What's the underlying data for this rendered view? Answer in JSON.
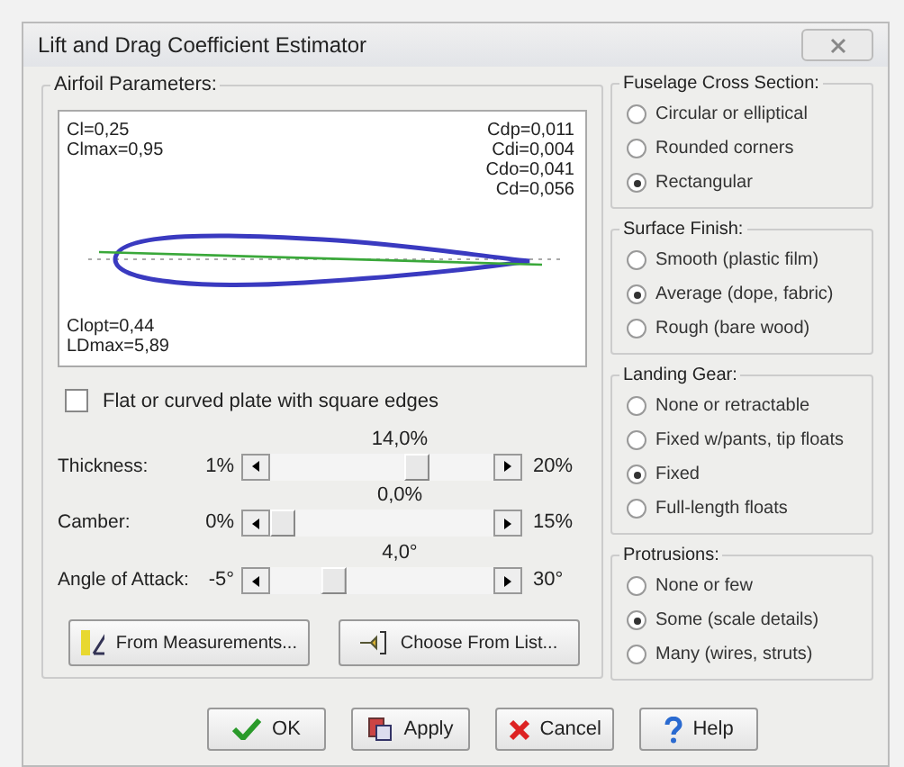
{
  "window": {
    "title": "Lift and Drag Coefficient Estimator"
  },
  "airfoil": {
    "title": "Airfoil Parameters:",
    "top_left": [
      "Cl=0,25",
      "Clmax=0,95"
    ],
    "top_right": [
      "Cdp=0,011",
      "Cdi=0,004",
      "Cdo=0,041",
      "Cd=0,056"
    ],
    "bottom_left": [
      "Clopt=0,44",
      "LDmax=5,89"
    ]
  },
  "flat_plate": {
    "label": "Flat or curved plate with square edges",
    "checked": false
  },
  "sliders": [
    {
      "label": "Thickness:",
      "min": "1%",
      "max": "20%",
      "reading": "14,0%",
      "level": 0.68
    },
    {
      "label": "Camber:",
      "min": "0%",
      "max": "15%",
      "reading": "0,0%",
      "level": 0.0
    },
    {
      "label": "Angle of Attack:",
      "min": "-5°",
      "max": "30°",
      "reading": "4,0°",
      "level": 0.26
    }
  ],
  "tool_buttons": [
    {
      "label": "From Measurements...",
      "kind": "measure"
    },
    {
      "label": "Choose From List...",
      "kind": "list"
    }
  ],
  "groups": [
    {
      "title": "Fuselage Cross Section:",
      "options": [
        {
          "label": "Circular or elliptical",
          "selected": false
        },
        {
          "label": "Rounded corners",
          "selected": false
        },
        {
          "label": "Rectangular",
          "selected": true
        }
      ]
    },
    {
      "title": "Surface Finish:",
      "options": [
        {
          "label": "Smooth (plastic film)",
          "selected": false
        },
        {
          "label": "Average (dope, fabric)",
          "selected": true
        },
        {
          "label": "Rough (bare wood)",
          "selected": false
        }
      ]
    },
    {
      "title": "Landing Gear:",
      "options": [
        {
          "label": "None or retractable",
          "selected": false
        },
        {
          "label": "Fixed w/pants, tip floats",
          "selected": false
        },
        {
          "label": "Fixed",
          "selected": true
        },
        {
          "label": "Full-length floats",
          "selected": false
        }
      ]
    },
    {
      "title": "Protrusions:",
      "options": [
        {
          "label": "None or few",
          "selected": false
        },
        {
          "label": "Some (scale details)",
          "selected": true
        },
        {
          "label": "Many (wires, struts)",
          "selected": false
        }
      ]
    }
  ],
  "buttons": [
    {
      "label": "OK",
      "kind": "ok"
    },
    {
      "label": "Apply",
      "kind": "apply"
    },
    {
      "label": "Cancel",
      "kind": "cancel"
    },
    {
      "label": "Help",
      "kind": "help"
    }
  ]
}
